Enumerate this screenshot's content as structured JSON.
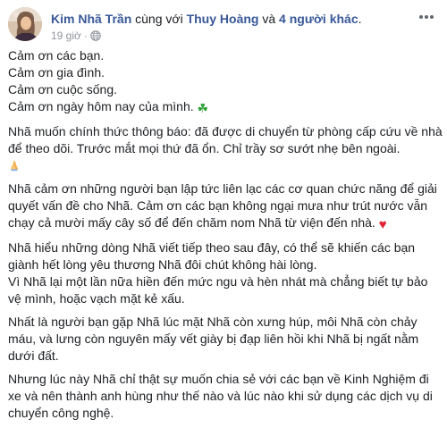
{
  "post": {
    "author": "Kim Nhã Trần",
    "with_text": " cùng với ",
    "tagged_user": "Thuy Hoàng",
    "and_text": " và ",
    "others_link": "4 người khác",
    "period": ".",
    "timestamp": "19 giờ",
    "dot": "·",
    "privacy_icon": "globe-icon",
    "menu_icon": "ellipsis-icon"
  },
  "content": {
    "thanks": [
      "Cảm ơn các bạn.",
      "Cảm ơn gia đình.",
      "Cảm ơn cuộc sống.",
      "Cảm ơn ngày hôm nay của mình. "
    ],
    "clover_emoji": "☘",
    "para1": "Nhã muốn chính thức thông báo: đã được di chuyển từ phòng cấp cứu về nhà để theo dõi. Trước mắt mọi thứ đã ổn. Chỉ trầy sơ sướt nhẹ bên ngoài.",
    "para2": "Nhã cảm ơn những người bạn lập tức liên lạc các cơ quan chức năng để giải quyết vấn đề cho Nhã. Cảm ơn các bạn không ngại mưa như trút nước vẫn chạy cả mười mấy cây số để đến chăm nom Nhã từ viện đến nhà. ",
    "heart_emoji": "♥",
    "para3a": "Nhã hiểu những dòng Nhã viết tiếp theo sau đây, có thể sẽ khiến các bạn giành hết lòng yêu thương Nhã đôi chút không hài lòng.",
    "para3b": "Vì Nhã lại một lần nữa hiền đến mức ngu và hèn nhát mà chẳng biết tự bảo vệ mình, hoặc vạch mặt kẻ xấu.",
    "para4": "Nhất là người bạn gặp Nhã lúc mặt Nhã còn xưng húp, môi Nhã còn chảy máu, và lưng còn nguyên mấy vết giày bị đạp liên hồi khi Nhã bị ngất nằm dưới đất.",
    "para5": "Nhưng lúc này Nhã chỉ thật sự muốn chia sẻ với các bạn về Kinh Nghiệm đi xe và nên thành anh hùng như thế nào và lúc nào khi sử dụng các dịch vụ di chuyển công nghệ."
  },
  "colors": {
    "link": "#385898",
    "text": "#1c1e21",
    "meta": "#90949c"
  }
}
